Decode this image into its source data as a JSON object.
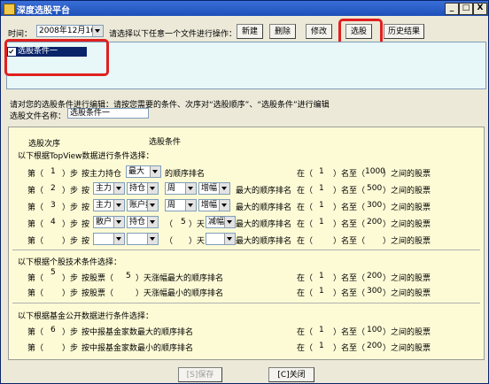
{
  "window": {
    "title": "深度选股平台",
    "minimize": "_",
    "maximize": "□",
    "close": "X"
  },
  "toolbar": {
    "time_label": "时间：",
    "date_value": "2008年12月16日",
    "prompt": "请选择以下任意一个文件进行操作：",
    "new_label": "新建",
    "delete_label": "删除",
    "modify_label": "修改",
    "select_label": "选股",
    "history_label": "历史结果"
  },
  "file_list": {
    "items": [
      "选股条件一"
    ]
  },
  "edit": {
    "instruction": "请对您的选股条件进行编辑：请按您需要的条件、次序对“选股顺序”、“选股条件”进行编辑",
    "file_name_label": "选股文件名称：",
    "file_name_value": "选股条件一"
  },
  "headers": {
    "order": "选股次序",
    "condition": "选股条件"
  },
  "section_topview": {
    "title": "以下根据TopView数据进行条件选择：",
    "rows": [
      {
        "step": "1",
        "prefix": "第（",
        "mid": "）步",
        "an": "按主力持仓",
        "c1": "最大",
        "text": "的顺序排名",
        "zai": "在（",
        "from": "1",
        "mz": "）名至（",
        "to": "1000",
        "end": "）之间的股票"
      },
      {
        "step": "2",
        "c1": "主力",
        "c2": "持仓",
        "c3": "周",
        "c4": "增幅",
        "text": "最大的顺序排名",
        "from": "1",
        "to": "500"
      },
      {
        "step": "3",
        "c1": "主力",
        "c2": "账户数",
        "c3": "周",
        "c4": "增幅",
        "text": "最大的顺序排名",
        "from": "1",
        "to": "300"
      },
      {
        "step": "4",
        "c1": "散户",
        "c2": "持仓",
        "days": "5",
        "tian": "）天",
        "c4": "减幅",
        "text": "最大的顺序排名",
        "from": "1",
        "to": "200"
      },
      {
        "step": "",
        "text": "最大的顺序排名",
        "from": "",
        "to": ""
      }
    ]
  },
  "section_tech": {
    "title": "以下根据个股技术条件选择：",
    "rows": [
      {
        "step": "5",
        "text": "按股票（",
        "days": "5",
        "tail": "）天涨幅最大的顺序排名",
        "from": "1",
        "to": "200"
      },
      {
        "step": "",
        "text": "按股票（",
        "days": "",
        "tail": "）天涨幅最小的顺序排名",
        "from": "1",
        "to": "300"
      }
    ]
  },
  "section_fund": {
    "title": "以下根据基金公开数据进行条件选择：",
    "rows": [
      {
        "step": "6",
        "text": "按中报基金家数最大的顺序排名",
        "from": "1",
        "to": "100"
      },
      {
        "step": "",
        "text": "按中报基金家数最小的顺序排名",
        "from": "1",
        "to": "200"
      }
    ]
  },
  "common": {
    "di": "第（",
    "bu": "）步",
    "an": "按",
    "zai": "在（",
    "ming_zhi": "）名至（",
    "zhijian": "）之间的股票",
    "tian": "）天",
    "paren": "（"
  },
  "footer": {
    "save_label": "[S]保存",
    "close_label": "[C]关闭"
  }
}
